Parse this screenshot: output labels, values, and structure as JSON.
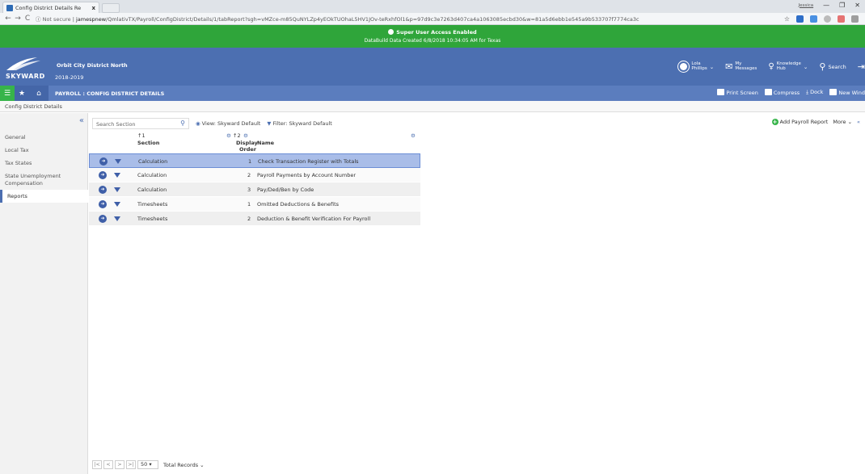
{
  "browser": {
    "tab_title": "Config District Details Re",
    "tab_close": "x",
    "user_tag": "Jessica",
    "win_minimize": "—",
    "win_restore": "❐",
    "win_close": "✕",
    "not_secure": "Not secure",
    "url_host": "jamespnew",
    "url_path": "/QmlativTX/Payroll/ConfigDistrict/Details/1/tabReport?sgh=vMZce-m85QuNYLZp4yEOkTUOhaL5HV1JOv-teRxhfOl1&p=97d9c3e7263d407ca4a1063085ecbd30&w=81a5d6ebb1e545a9b533707f7774ca3c"
  },
  "banner": {
    "line1": "Super User Access Enabled",
    "line2": "DataBuild Data Created 6/8/2018 10:34:05 AM for Texas"
  },
  "header": {
    "district_name": "Orbit City District North",
    "school_year": "2018-2019",
    "user_first": "Lola",
    "user_last": "Phillips",
    "messages_l1": "My",
    "messages_l2": "Messages",
    "hub_l1": "Knowledge",
    "hub_l2": "Hub",
    "search": "Search",
    "logo_text": "SKYWARD"
  },
  "subheader": {
    "title": "PAYROLL : CONFIG DISTRICT DETAILS",
    "print_screen": "Print Screen",
    "compress": "Compress",
    "dock": "Dock",
    "new_window": "New Wind"
  },
  "breadcrumb": "Config District Details",
  "leftnav": {
    "items": [
      {
        "label": "General"
      },
      {
        "label": "Local Tax"
      },
      {
        "label": "Tax States"
      },
      {
        "label": "State Unemployment Compensation"
      },
      {
        "label": "Reports"
      }
    ]
  },
  "toolbar": {
    "search_placeholder": "Search Section",
    "view_label": "View: Skyward Default",
    "filter_label": "Filter: Skyward Default",
    "add_report": "Add Payroll Report",
    "more": "More"
  },
  "grid": {
    "sort1": "↑1",
    "sort2": "↑2",
    "col_section": "Section",
    "col_display_l1": "Display",
    "col_display_l2": "Order",
    "col_name": "Name",
    "rows": [
      {
        "section": "Calculation",
        "order": "1",
        "name": "Check Transaction Register with Totals"
      },
      {
        "section": "Calculation",
        "order": "2",
        "name": "Payroll Payments by Account Number"
      },
      {
        "section": "Calculation",
        "order": "3",
        "name": "Pay/Ded/Ben by Code"
      },
      {
        "section": "Timesheets",
        "order": "1",
        "name": "Omitted Deductions & Benefits"
      },
      {
        "section": "Timesheets",
        "order": "2",
        "name": "Deduction & Benefit Verification For Payroll"
      }
    ]
  },
  "pager": {
    "page_size": "50",
    "total_records": "Total Records"
  }
}
